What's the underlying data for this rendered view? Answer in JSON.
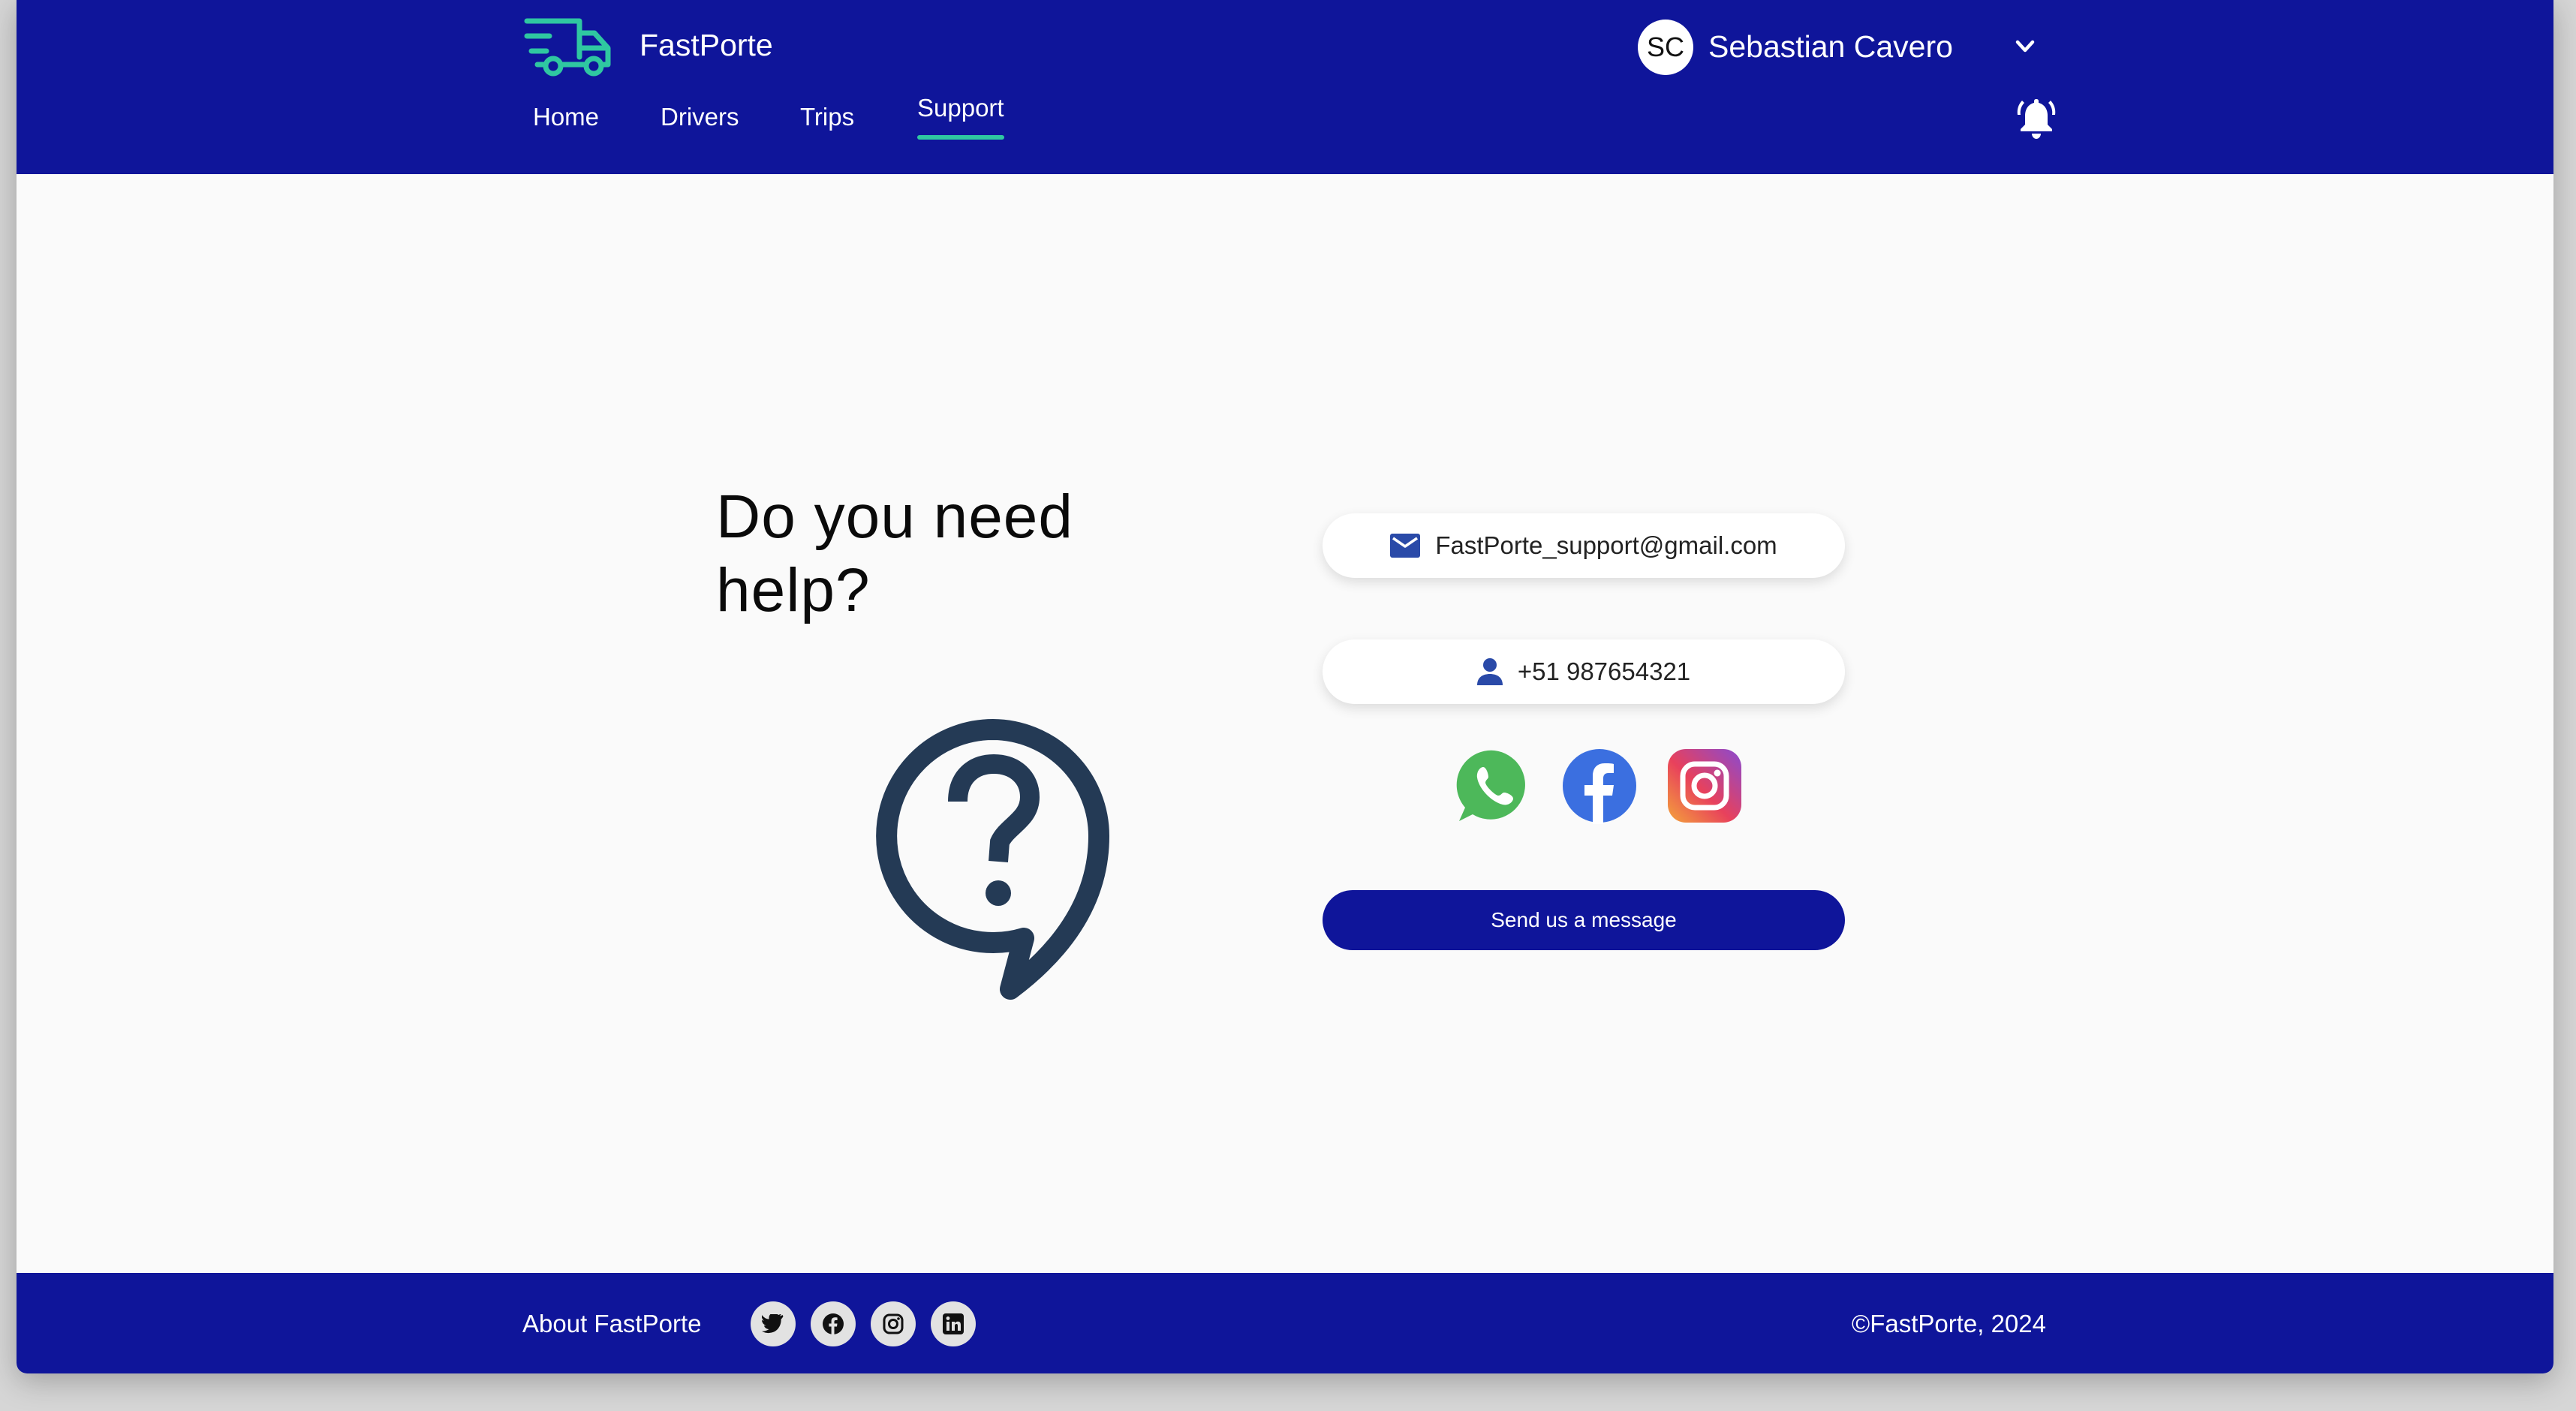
{
  "header": {
    "app_name": "FastPorte",
    "nav": [
      {
        "label": "Home"
      },
      {
        "label": "Drivers"
      },
      {
        "label": "Trips"
      },
      {
        "label": "Support",
        "active": true
      }
    ],
    "user": {
      "initials": "SC",
      "name": "Sebastian Cavero"
    },
    "icons": {
      "logo": "delivery-truck-icon",
      "user_menu": "chevron-down-icon",
      "notifications": "bell-icon"
    }
  },
  "main": {
    "headline": "Do you need help?",
    "illustration": "question-speech-bubble-icon",
    "email": "FastPorte_support@gmail.com",
    "phone": "+51 987654321",
    "social": [
      "whatsapp-icon",
      "facebook-icon",
      "instagram-icon"
    ],
    "send_button": "Send us a message"
  },
  "footer": {
    "about": "About FastPorte",
    "social": [
      "twitter-icon",
      "facebook-icon",
      "instagram-icon",
      "linkedin-icon"
    ],
    "copyright": "©FastPorte, 2024"
  },
  "colors": {
    "brand_blue": "#0f159a",
    "accent_green": "#2fc7a1",
    "help_icon": "#243a55",
    "pill_icon": "#2a4aa8"
  }
}
